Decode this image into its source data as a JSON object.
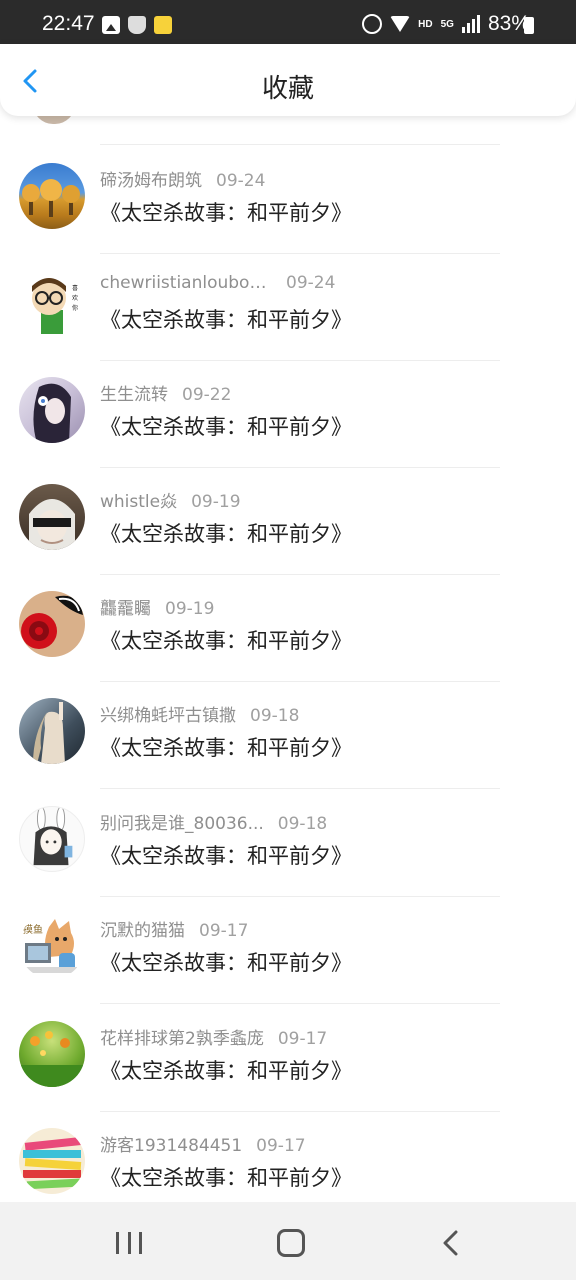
{
  "status_bar": {
    "time": "22:47",
    "battery": "83%",
    "network": "HD",
    "network_gen": "5G",
    "icons": [
      "gallery-icon",
      "shield-icon",
      "app-icon",
      "alarm-icon",
      "wifi-icon",
      "signal-icon",
      "battery-icon"
    ]
  },
  "header": {
    "title": "收藏",
    "back_icon": "chevron-left-icon",
    "accent": "#2196f3"
  },
  "items": [
    {
      "username": "碲汤姆布朗筑",
      "date": "09-24",
      "title": "《太空杀故事：和平前夕》",
      "avatar": "autumn-trees"
    },
    {
      "username": "chewriistianloubou...",
      "date": "09-24",
      "title": "《太空杀故事：和平前夕》",
      "avatar": "cartoon-glasses"
    },
    {
      "username": "生生流转",
      "date": "09-22",
      "title": "《太空杀故事：和平前夕》",
      "avatar": "anime-girl-flower"
    },
    {
      "username": "whistle焱",
      "date": "09-19",
      "title": "《太空杀故事：和平前夕》",
      "avatar": "blindfold-character"
    },
    {
      "username": "龘靇矚",
      "date": "09-19",
      "title": "《太空杀故事：和平前夕》",
      "avatar": "red-rose"
    },
    {
      "username": "兴绑桷蚝坪古镇撒",
      "date": "09-18",
      "title": "《太空杀故事：和平前夕》",
      "avatar": "girl-photo"
    },
    {
      "username": "别问我是谁_80036...",
      "date": "09-18",
      "title": "《太空杀故事：和平前夕》",
      "avatar": "bunny-girl-sketch"
    },
    {
      "username": "沉默的猫猫",
      "date": "09-17",
      "title": "《太空杀故事：和平前夕》",
      "avatar": "cat-computer"
    },
    {
      "username": "花样排球第2孰季螽庞",
      "date": "09-17",
      "title": "《太空杀故事：和平前夕》",
      "avatar": "green-flowers"
    },
    {
      "username": "游客1931484451",
      "date": "09-17",
      "title": "《太空杀故事：和平前夕》",
      "avatar": "colorful-books"
    }
  ],
  "navigation_bar": {
    "icons": [
      "recent-apps-icon",
      "home-icon",
      "back-icon"
    ]
  }
}
